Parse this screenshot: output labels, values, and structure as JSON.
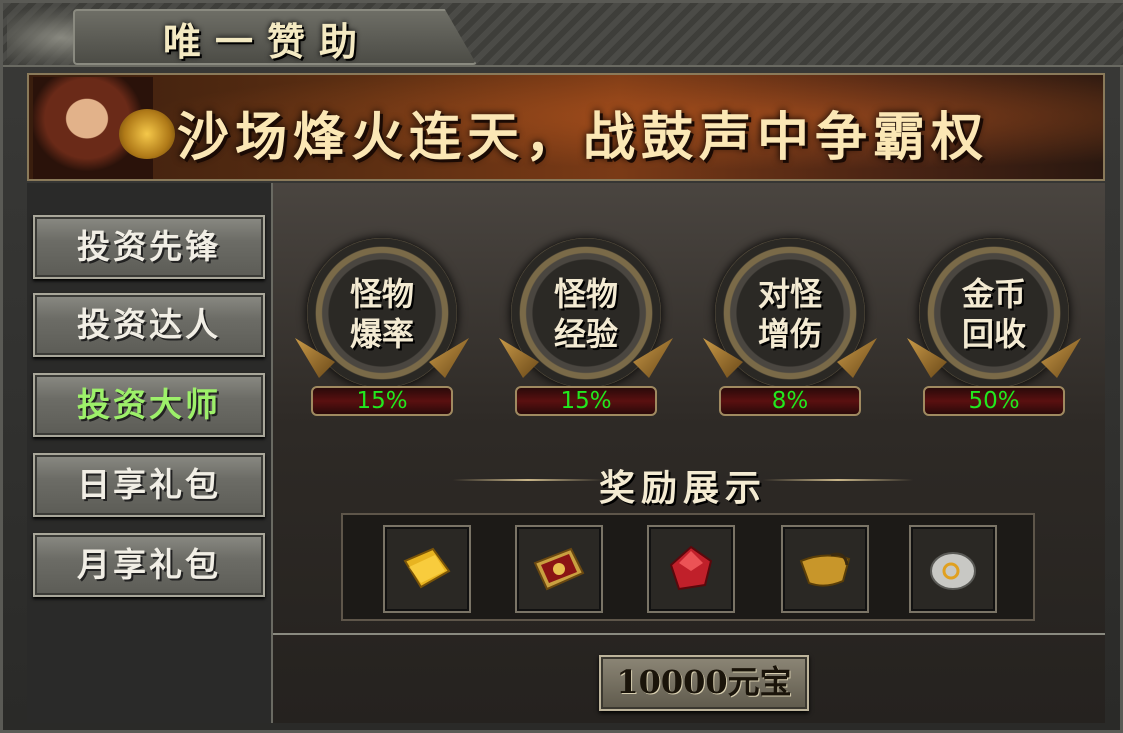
{
  "window": {
    "title": "唯一赞助"
  },
  "banner": {
    "slogan": "沙场烽火连天，战鼓声中争霸权"
  },
  "sidebar": {
    "items": [
      {
        "label": "投资先锋",
        "active": false
      },
      {
        "label": "投资达人",
        "active": false
      },
      {
        "label": "投资大师",
        "active": true
      },
      {
        "label": "日享礼包",
        "active": false
      },
      {
        "label": "月享礼包",
        "active": false
      }
    ]
  },
  "bonuses": [
    {
      "line1": "怪物",
      "line2": "爆率",
      "value": "15%"
    },
    {
      "line1": "怪物",
      "line2": "经验",
      "value": "15%"
    },
    {
      "line1": "对怪",
      "line2": "增伤",
      "value": "8%"
    },
    {
      "line1": "金币",
      "line2": "回收",
      "value": "50%"
    }
  ],
  "rewards": {
    "title": "奖励展示",
    "items": [
      "gold-scroll-icon",
      "red-book-icon",
      "red-gem-icon",
      "belt-icon",
      "silver-ore-icon"
    ]
  },
  "price_button": {
    "label": "10000元宝"
  },
  "colors": {
    "active_text": "#9df06a",
    "percent_text": "#22e81e"
  }
}
